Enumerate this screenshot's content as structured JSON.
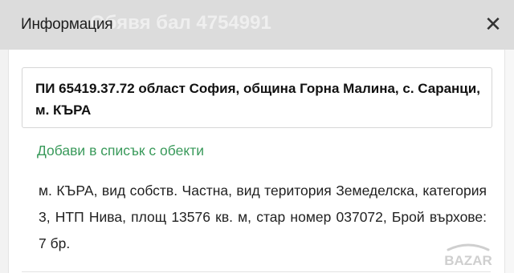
{
  "header": {
    "title": "Информация",
    "ghost_text": "Обявя бал 4754991",
    "close_symbol": "✕"
  },
  "card": {
    "title": "ПИ 65419.37.72 област София, община Горна Малина, с. Саранци, м. КЪРА"
  },
  "add_link": {
    "label": "Добави в списък с обекти"
  },
  "details": {
    "text": "м. КЪРА, вид собств. Частна, вид територия Земеделска, категория 3, НТП Нива, площ 13576 кв. м, стар номер 037072, Брой върхове: 7 бр."
  },
  "watermark": {
    "logo_text": "BAZAR"
  },
  "colors": {
    "header_bg": "#dcdcdc",
    "link_green": "#3a9a5b",
    "text": "#222222"
  }
}
